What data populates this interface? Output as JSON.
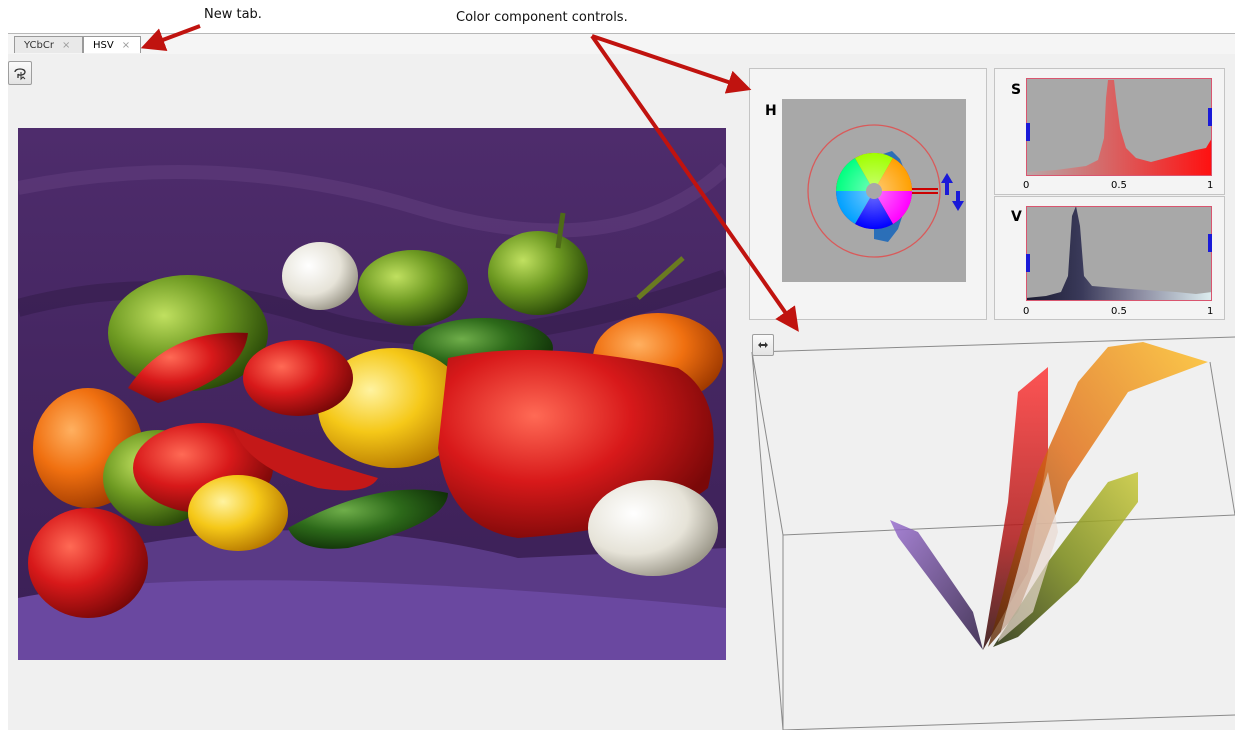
{
  "annotations": {
    "new_tab": "New tab.",
    "color_controls": "Color component controls."
  },
  "tabs": [
    {
      "label": "YCbCr",
      "active": false
    },
    {
      "label": "HSV",
      "active": true
    }
  ],
  "tab_close_glyph": "×",
  "controls": {
    "h": {
      "label": "H"
    },
    "s": {
      "label": "S",
      "ticks": [
        "0",
        "0.5",
        "1"
      ]
    },
    "v": {
      "label": "V",
      "ticks": [
        "0",
        "0.5",
        "1"
      ]
    }
  },
  "icons": {
    "image_select": "lasso-select-icon",
    "cloud_rotate": "rotate-icon"
  },
  "colors": {
    "arrow": "#c0130f",
    "handle": "#1a1ad8",
    "hist_border": "#d9556f",
    "hist_bg": "#a8a8a8"
  }
}
